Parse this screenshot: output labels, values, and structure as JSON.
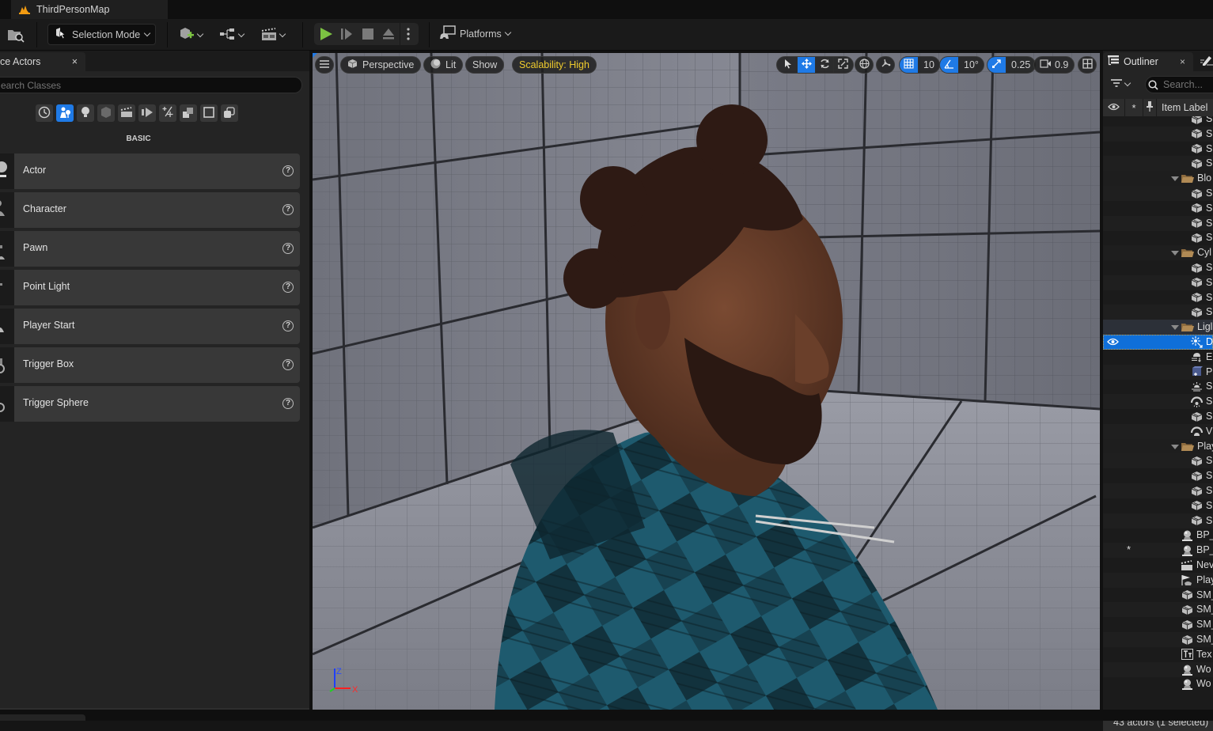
{
  "window": {
    "document_tab": "ThirdPersonMap"
  },
  "toolbar": {
    "selection_mode": "Selection Mode",
    "platforms": "Platforms"
  },
  "place_actors": {
    "tab_label": "ce Actors",
    "close": "×",
    "search_placeholder": "earch Classes",
    "category_label": "BASIC",
    "categories": [
      "recently-placed",
      "basic",
      "lights",
      "shapes",
      "cinematic",
      "visual-effects",
      "all-volumes",
      "all-classes",
      "geometry",
      "volumes"
    ],
    "items": [
      {
        "label": "Actor"
      },
      {
        "label": "Character"
      },
      {
        "label": "Pawn"
      },
      {
        "label": "Point Light"
      },
      {
        "label": "Player Start"
      },
      {
        "label": "Trigger Box"
      },
      {
        "label": "Trigger Sphere"
      }
    ],
    "help_glyph": "?"
  },
  "viewport": {
    "view_mode": "Perspective",
    "lighting": "Lit",
    "show": "Show",
    "scalability": "Scalability: High",
    "grid_snap": "10",
    "rotation_snap": "10°",
    "scale_snap": "0.25",
    "camera_speed": "0.9",
    "axis": {
      "z": "Z",
      "x": "X",
      "y": "Y"
    }
  },
  "outliner": {
    "tab_label": "Outliner",
    "close": "×",
    "search_placeholder": "Search...",
    "column_item_label": "Item Label",
    "rows": [
      {
        "type": "mesh",
        "text": "S",
        "depth": 2
      },
      {
        "type": "mesh",
        "text": "S",
        "depth": 2
      },
      {
        "type": "mesh",
        "text": "S",
        "depth": 2
      },
      {
        "type": "mesh",
        "text": "S",
        "depth": 2
      },
      {
        "type": "folder",
        "text": "Blo",
        "depth": 1
      },
      {
        "type": "mesh",
        "text": "S",
        "depth": 2
      },
      {
        "type": "mesh",
        "text": "S",
        "depth": 2
      },
      {
        "type": "mesh",
        "text": "S",
        "depth": 2
      },
      {
        "type": "mesh",
        "text": "S",
        "depth": 2
      },
      {
        "type": "folder",
        "text": "Cyl",
        "depth": 1
      },
      {
        "type": "mesh",
        "text": "S",
        "depth": 2
      },
      {
        "type": "mesh",
        "text": "S",
        "depth": 2
      },
      {
        "type": "mesh",
        "text": "S",
        "depth": 2
      },
      {
        "type": "mesh",
        "text": "S",
        "depth": 2
      },
      {
        "type": "folder",
        "text": "Ligl",
        "depth": 1
      },
      {
        "type": "directional-light",
        "text": "D",
        "depth": 2,
        "selected": true
      },
      {
        "type": "exponential-fog",
        "text": "E",
        "depth": 2
      },
      {
        "type": "post-process",
        "text": "P",
        "depth": 2
      },
      {
        "type": "sky-atmosphere",
        "text": "S",
        "depth": 2
      },
      {
        "type": "sky-light",
        "text": "S",
        "depth": 2
      },
      {
        "type": "mesh",
        "text": "S",
        "depth": 2
      },
      {
        "type": "volumetric-cloud",
        "text": "V",
        "depth": 2
      },
      {
        "type": "folder",
        "text": "Play",
        "depth": 1
      },
      {
        "type": "mesh",
        "text": "S",
        "depth": 2
      },
      {
        "type": "mesh",
        "text": "S",
        "depth": 2
      },
      {
        "type": "mesh",
        "text": "S",
        "depth": 2
      },
      {
        "type": "mesh",
        "text": "S",
        "depth": 2
      },
      {
        "type": "mesh",
        "text": "S",
        "depth": 2
      },
      {
        "type": "blueprint",
        "text": "BP_",
        "depth": 0
      },
      {
        "type": "blueprint",
        "text": "BP_",
        "depth": 0,
        "starred": true
      },
      {
        "type": "level-sequence",
        "text": "Nev",
        "depth": 0
      },
      {
        "type": "player-start",
        "text": "Play",
        "depth": 0
      },
      {
        "type": "mesh",
        "text": "SM_",
        "depth": 0
      },
      {
        "type": "mesh",
        "text": "SM_",
        "depth": 0
      },
      {
        "type": "mesh",
        "text": "SM_",
        "depth": 0
      },
      {
        "type": "mesh",
        "text": "SM_",
        "depth": 0
      },
      {
        "type": "text-render",
        "text": "Tex",
        "depth": 0
      },
      {
        "type": "blueprint",
        "text": "Wo",
        "depth": 0
      },
      {
        "type": "blueprint",
        "text": "Wo",
        "depth": 0
      }
    ],
    "status": "43 actors (1 selected)"
  },
  "colors": {
    "accent_blue": "#1f7ae6",
    "play_green": "#7cc242",
    "scalability_yellow": "#f0cc2d",
    "folder_tan": "#b08a55"
  }
}
